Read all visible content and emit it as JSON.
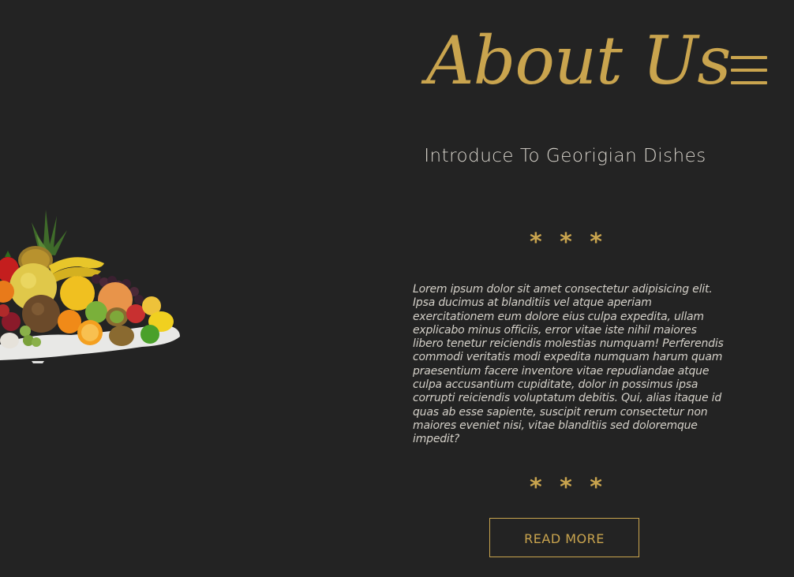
{
  "header": {
    "title": "About Us",
    "menu_icon": "hamburger-menu-icon"
  },
  "intro": {
    "subtitle": "Introduce To Georigian Dishes",
    "stars_top": "* * *",
    "body": "Lorem ipsum dolor sit amet consectetur adipisicing elit. Ipsa ducimus at blanditiis vel atque aperiam exercitationem eum dolore eius culpa expedita, ullam explicabo minus officiis, error vitae iste nihil maiores libero tenetur reiciendis molestias numquam! Perferendis commodi veritatis modi expedita numquam harum quam praesentium facere inventore vitae repudiandae atque culpa accusantium cupiditate, dolor in possimus ipsa corrupti reiciendis voluptatum debitis. Qui, alias itaque id quas ab esse sapiente, suscipit rerum consectetur non maiores eveniet nisi, vitae blanditiis sed doloremque impedit?",
    "stars_bottom": "* * *",
    "button_label": "READ MORE"
  },
  "image": {
    "semantic": "fruit-arrangement-image"
  },
  "colors": {
    "background": "#232323",
    "accent": "#c9a44e",
    "text": "#d8d4cc"
  }
}
